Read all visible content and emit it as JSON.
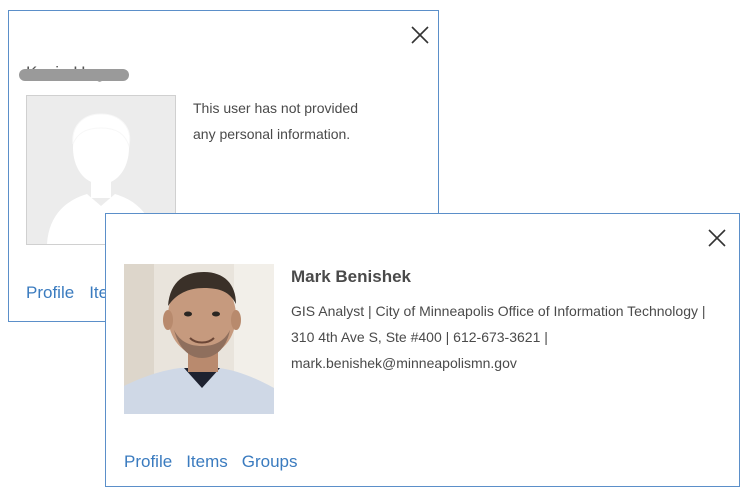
{
  "back_card": {
    "user_name": "Kevin Hogue",
    "avatar_icon": "default-user-silhouette-icon",
    "message": "This user has not provided any personal information.",
    "links": [
      "Profile",
      "Items"
    ]
  },
  "front_card": {
    "user_name": "Mark Benishek",
    "photo_icon": "user-photo",
    "bio": "GIS Analyst | City of Minneapolis Office of Information Technology | 310 4th Ave S, Ste #400 | 612-673-3621 | mark.benishek@minneapolismn.gov",
    "links": [
      "Profile",
      "Items",
      "Groups"
    ]
  },
  "colors": {
    "border": "#5b8fc9",
    "link": "#3a7bbf",
    "text": "#4a4a4a",
    "placeholder_bg": "#ececec"
  }
}
